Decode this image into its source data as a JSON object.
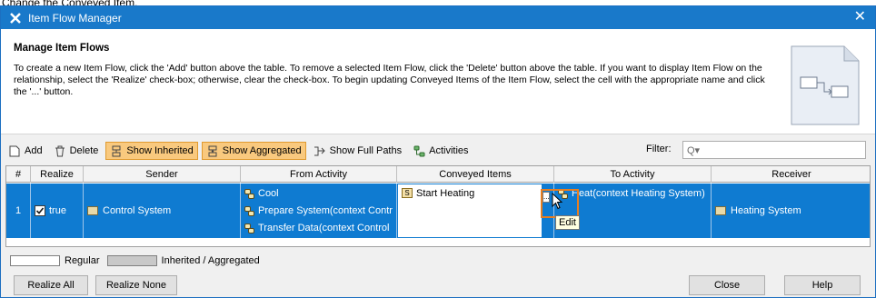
{
  "caption": "Change the Conveyed Item.",
  "window": {
    "title": "Item Flow Manager",
    "close_glyph": "✕"
  },
  "header": {
    "title": "Manage Item Flows",
    "description": "To create a new Item Flow, click the 'Add' button above the table. To remove a selected Item Flow, click the 'Delete' button above the table. If you want to display Item Flow on the relationship, select the 'Realize' check-box; otherwise, clear the check-box. To begin updating Conveyed Items of the Item Flow, select the cell with the appropriate name and click the '...' button."
  },
  "toolbar": {
    "add_label": "Add",
    "delete_label": "Delete",
    "show_inherited_label": "Show Inherited",
    "show_aggregated_label": "Show Aggregated",
    "show_full_paths_label": "Show Full Paths",
    "activities_label": "Activities",
    "filter_label": "Filter:",
    "filter_placeholder": "Q▾"
  },
  "table": {
    "columns": [
      "#",
      "Realize",
      "Sender",
      "From Activity",
      "Conveyed Items",
      "To Activity",
      "Receiver"
    ],
    "rows": [
      {
        "number": "1",
        "realize": "true",
        "sender": "Control System",
        "from_activities": [
          "Cool",
          "Prepare System(context Contr",
          "Transfer Data(context Control"
        ],
        "conveyed_items": "Start Heating",
        "to_activity": "Heat(context Heating System)",
        "receiver": "Heating System"
      }
    ]
  },
  "tooltip": "Edit",
  "ellipsis_glyph": "...",
  "legend": {
    "regular": "Regular",
    "inherited": "Inherited / Aggregated"
  },
  "footer": {
    "realize_all": "Realize All",
    "realize_none": "Realize None",
    "close": "Close",
    "help": "Help"
  },
  "colors": {
    "titlebar": "#1979ca",
    "selection": "#0f7bd1",
    "toggle": "#f9c97e",
    "highlight_border": "#e67e22"
  }
}
